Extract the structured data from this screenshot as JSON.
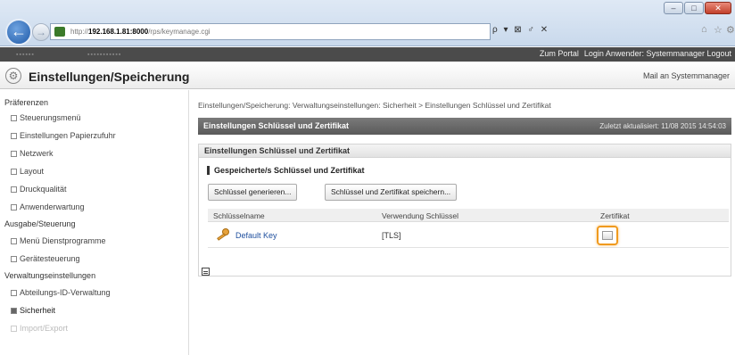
{
  "browser": {
    "url_prefix": "http://",
    "url_host": "192.168.1.81:8000",
    "url_path": "/rps/keymanage.cgi",
    "addr_tools": "ρ ▾ ⊠ ♂ ✕"
  },
  "app": {
    "top_links": [
      "Zum Portal",
      "Login Anwender: Systemmanager Logout"
    ],
    "title": "Einstellungen/Speicherung",
    "mail_link": "Mail an Systemmanager"
  },
  "sidebar": {
    "groups": [
      {
        "label": "Präferenzen",
        "items": [
          "Steuerungsmenü",
          "Einstellungen Papierzufuhr",
          "Netzwerk",
          "Layout",
          "Druckqualität",
          "Anwenderwartung"
        ]
      },
      {
        "label": "Ausgabe/Steuerung",
        "items": [
          "Menü Dienstprogramme",
          "Gerätesteuerung"
        ]
      },
      {
        "label": "Verwaltungseinstellungen",
        "items": [
          "Abteilungs-ID-Verwaltung",
          "Sicherheit",
          "Import/Export"
        ]
      }
    ]
  },
  "main": {
    "breadcrumb": "Einstellungen/Speicherung: Verwaltungseinstellungen: Sicherheit > Einstellungen Schlüssel und Zertifikat",
    "panel_title": "Einstellungen Schlüssel und Zertifikat",
    "updated": "Zuletzt aktualisiert: 11/08 2015 14:54:03",
    "section_title": "Einstellungen Schlüssel und Zertifikat",
    "subheading": "Gespeicherte/s Schlüssel und Zertifikat",
    "buttons": {
      "generate": "Schlüssel generieren...",
      "register": "Schlüssel und Zertifikat speichern..."
    },
    "table": {
      "headers": [
        "Schlüsselname",
        "Verwendung Schlüssel",
        "Zertifikat"
      ],
      "rows": [
        {
          "name": "Default Key",
          "usage": "[TLS]"
        }
      ]
    }
  }
}
